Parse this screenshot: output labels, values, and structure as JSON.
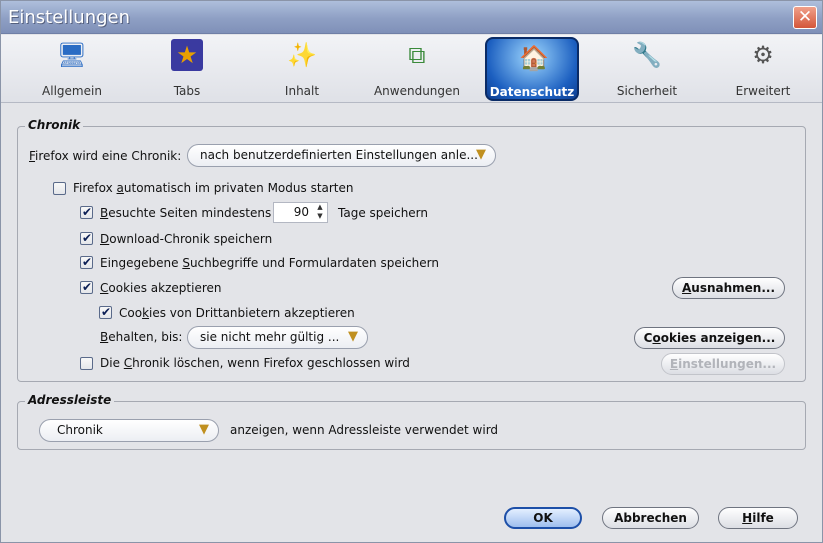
{
  "window": {
    "title": "Einstellungen",
    "close": "✕"
  },
  "panes": [
    {
      "label": "Allgemein",
      "icon": "general-monitor-icon",
      "glyph": "🖥"
    },
    {
      "label": "Tabs",
      "icon": "tabs-icon",
      "glyph": "★"
    },
    {
      "label": "Inhalt",
      "icon": "content-icon",
      "glyph": "✨"
    },
    {
      "label": "Anwendungen",
      "icon": "applications-icon",
      "glyph": "⧉"
    },
    {
      "label": "Datenschutz",
      "icon": "privacy-icon",
      "glyph": "🏠"
    },
    {
      "label": "Sicherheit",
      "icon": "security-icon",
      "glyph": "🔧"
    },
    {
      "label": "Erweitert",
      "icon": "advanced-gear-icon",
      "glyph": "⚙"
    }
  ],
  "selected_pane": "Datenschutz",
  "chronik": {
    "caption": "Chronik",
    "firefox_label_pre": "",
    "firefox_label_u": "F",
    "firefox_label_post": "irefox wird eine Chronik:",
    "mode_value": "nach benutzerdefinierten Einstellungen anle...",
    "private_pre": "Firefox ",
    "private_u": "a",
    "private_post": "utomatisch im privaten Modus starten",
    "private_checked": false,
    "visited_u": "B",
    "visited_post": "esuchte Seiten mindestens",
    "visited_checked": true,
    "days": "90",
    "days_suffix": "Tage speichern",
    "download_u": "D",
    "download_post": "ownload-Chronik speichern",
    "download_checked": true,
    "search_pre": "Eingegebene ",
    "search_u": "S",
    "search_post": "uchbegriffe und Formulardaten speichern",
    "search_checked": true,
    "cookies_u": "C",
    "cookies_post": "ookies akzeptieren",
    "cookies_checked": true,
    "exceptions_u": "A",
    "exceptions_post": "usnahmen...",
    "thirdparty_pre": "Coo",
    "thirdparty_u": "k",
    "thirdparty_post": "ies von Drittanbietern akzeptieren",
    "thirdparty_checked": true,
    "keep_pre": "",
    "keep_u": "B",
    "keep_post": "ehalten, bis:",
    "keep_value": "sie nicht mehr gültig ...",
    "showcookies_pre": "C",
    "showcookies_u": "o",
    "showcookies_post": "okies anzeigen...",
    "clear_pre": "Die ",
    "clear_u": "C",
    "clear_post": "hronik löschen, wenn Firefox geschlossen wird",
    "clear_checked": false,
    "settings_u": "E",
    "settings_post": "instellungen..."
  },
  "adressleiste": {
    "caption": "Adressleiste",
    "value": "Chronik",
    "suffix": "anzeigen, wenn Adressleiste verwendet wird"
  },
  "buttons": {
    "ok": "OK",
    "cancel": "Abbrechen",
    "help_u": "H",
    "help_post": "ilfe"
  }
}
